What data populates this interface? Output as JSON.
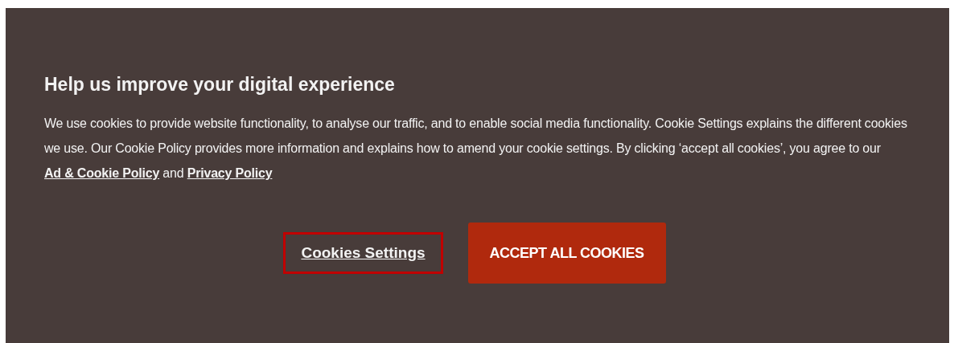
{
  "banner": {
    "title": "Help us improve your digital experience",
    "body": [
      {
        "kind": "text",
        "text": "We use cookies to provide website functionality, to analyse our traffic, and to enable social media functionality. Cookie Settings explains the different cookies we use. Our Cookie Policy provides more information and explains how to amend your cookie settings. By clicking ‘accept all cookies’, you agree to our "
      },
      {
        "kind": "link",
        "text": "Ad & Cookie Policy"
      },
      {
        "kind": "text",
        "text": " and "
      },
      {
        "kind": "link",
        "text": "Privacy Policy"
      }
    ],
    "buttons": [
      {
        "kind": "link",
        "label": "Cookies Settings",
        "focused": true
      },
      {
        "kind": "primary",
        "label": "ACCEPT ALL COOKIES",
        "focused": false
      }
    ]
  }
}
